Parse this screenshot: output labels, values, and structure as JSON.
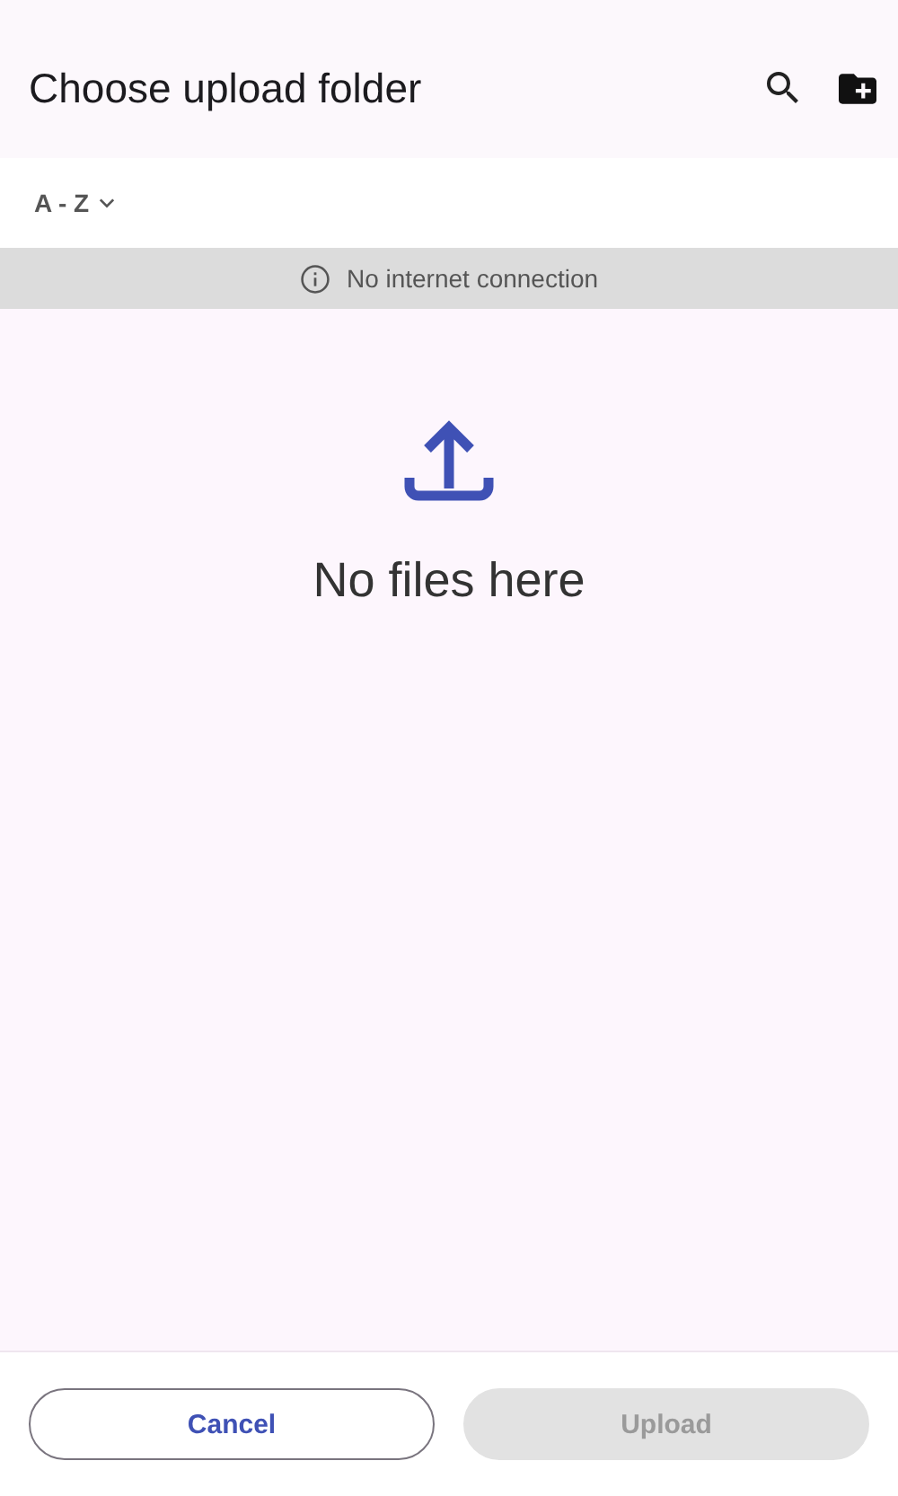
{
  "header": {
    "title": "Choose upload folder"
  },
  "sort": {
    "label": "A - Z"
  },
  "banner": {
    "text": "No internet connection"
  },
  "empty_state": {
    "text": "No files here"
  },
  "buttons": [
    {
      "label": "Cancel",
      "kind": "outlined",
      "disabled": false
    },
    {
      "label": "Upload",
      "kind": "filled",
      "disabled": true
    }
  ]
}
